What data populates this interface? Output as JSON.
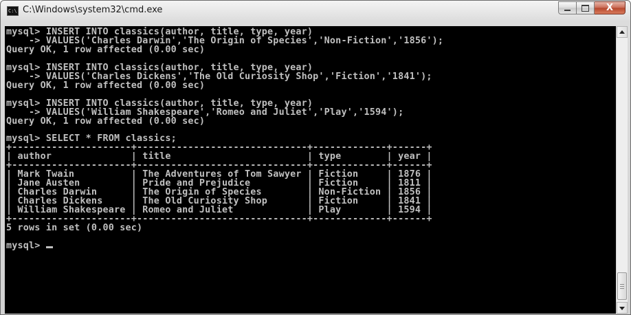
{
  "window": {
    "title": "C:\\Windows\\system32\\cmd.exe",
    "icon_label": "C:\\",
    "minimize_icon": "minimize-icon",
    "maximize_icon": "maximize-icon",
    "close_icon": "close-icon",
    "close_glyph": "X"
  },
  "console": {
    "lines": [
      "mysql> INSERT INTO classics(author, title, type, year)",
      "    -> VALUES('Charles Darwin','The Origin of Species','Non-Fiction','1856');",
      "Query OK, 1 row affected (0.00 sec)",
      "",
      "mysql> INSERT INTO classics(author, title, type, year)",
      "    -> VALUES('Charles Dickens','The Old Curiosity Shop','Fiction','1841');",
      "Query OK, 1 row affected (0.00 sec)",
      "",
      "mysql> INSERT INTO classics(author, title, type, year)",
      "    -> VALUES('William Shakespeare','Romeo and Juliet','Play','1594');",
      "Query OK, 1 row affected (0.00 sec)",
      "",
      "mysql> SELECT * FROM classics;",
      "+---------------------+------------------------------+-------------+------+",
      "| author              | title                        | type        | year |",
      "+---------------------+------------------------------+-------------+------+",
      "| Mark Twain          | The Adventures of Tom Sawyer | Fiction     | 1876 |",
      "| Jane Austen         | Pride and Prejudice          | Fiction     | 1811 |",
      "| Charles Darwin      | The Origin of Species        | Non-Fiction | 1856 |",
      "| Charles Dickens     | The Old Curiosity Shop       | Fiction     | 1841 |",
      "| William Shakespeare | Romeo and Juliet             | Play        | 1594 |",
      "+---------------------+------------------------------+-------------+------+",
      "5 rows in set (0.00 sec)",
      "",
      "mysql> "
    ],
    "foreground": "#c0c0c0",
    "background": "#000000"
  }
}
